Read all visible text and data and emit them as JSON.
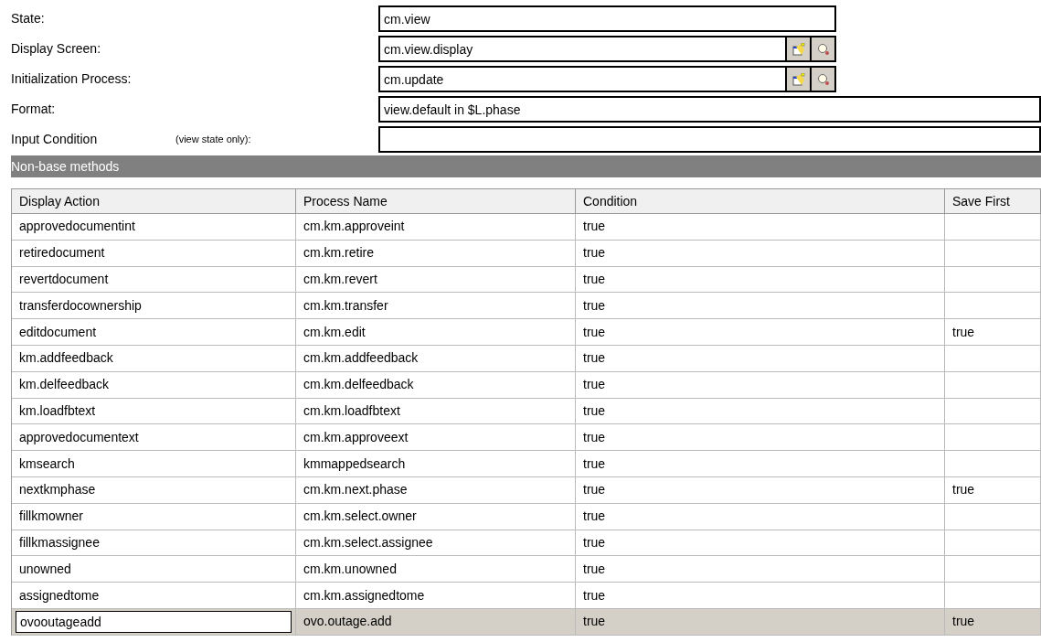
{
  "form": {
    "fields": [
      {
        "label": "State:",
        "value": "cm.view",
        "kind": "short"
      },
      {
        "label": "Display Screen:",
        "value": "cm.view.display",
        "kind": "lookup"
      },
      {
        "label": "Initialization Process:",
        "value": "cm.update",
        "kind": "lookup"
      },
      {
        "label": "Format:",
        "value": "view.default in $L.phase",
        "kind": "wide"
      },
      {
        "label": "Input Condition",
        "note": "(view state only):",
        "kind": "wide"
      }
    ]
  },
  "section": {
    "title": "Non-base methods"
  },
  "table": {
    "columns": [
      "Display Action",
      "Process Name",
      "Condition",
      "Save First"
    ],
    "rows": [
      {
        "cells": [
          "approvedocumentint",
          "cm.km.approveint",
          "true",
          ""
        ],
        "selected": false
      },
      {
        "cells": [
          "retiredocument",
          "cm.km.retire",
          "true",
          ""
        ],
        "selected": false
      },
      {
        "cells": [
          "revertdocument",
          "cm.km.revert",
          "true",
          ""
        ],
        "selected": false
      },
      {
        "cells": [
          "transferdocownership",
          "cm.km.transfer",
          "true",
          ""
        ],
        "selected": false
      },
      {
        "cells": [
          "editdocument",
          "cm.km.edit",
          "true",
          "true"
        ],
        "selected": false
      },
      {
        "cells": [
          "km.addfeedback",
          "cm.km.addfeedback",
          "true",
          ""
        ],
        "selected": false
      },
      {
        "cells": [
          "km.delfeedback",
          "cm.km.delfeedback",
          "true",
          ""
        ],
        "selected": false
      },
      {
        "cells": [
          "km.loadfbtext",
          "cm.km.loadfbtext",
          "true",
          ""
        ],
        "selected": false
      },
      {
        "cells": [
          "approvedocumentext",
          "cm.km.approveext",
          "true",
          ""
        ],
        "selected": false
      },
      {
        "cells": [
          "kmsearch",
          "kmmappedsearch",
          "true",
          ""
        ],
        "selected": false
      },
      {
        "cells": [
          "nextkmphase",
          "cm.km.next.phase",
          "true",
          "true"
        ],
        "selected": false
      },
      {
        "cells": [
          "fillkmowner",
          "cm.km.select.owner",
          "true",
          ""
        ],
        "selected": false
      },
      {
        "cells": [
          "fillkmassignee",
          "cm.km.select.assignee",
          "true",
          ""
        ],
        "selected": false
      },
      {
        "cells": [
          "unowned",
          "cm.km.unowned",
          "true",
          ""
        ],
        "selected": false
      },
      {
        "cells": [
          "assignedtome",
          "cm.km.assignedtome",
          "true",
          ""
        ],
        "selected": false
      },
      {
        "cells": [
          "ovooutageadd",
          "ovo.outage.add",
          "true",
          "true"
        ],
        "selected": true
      }
    ]
  }
}
